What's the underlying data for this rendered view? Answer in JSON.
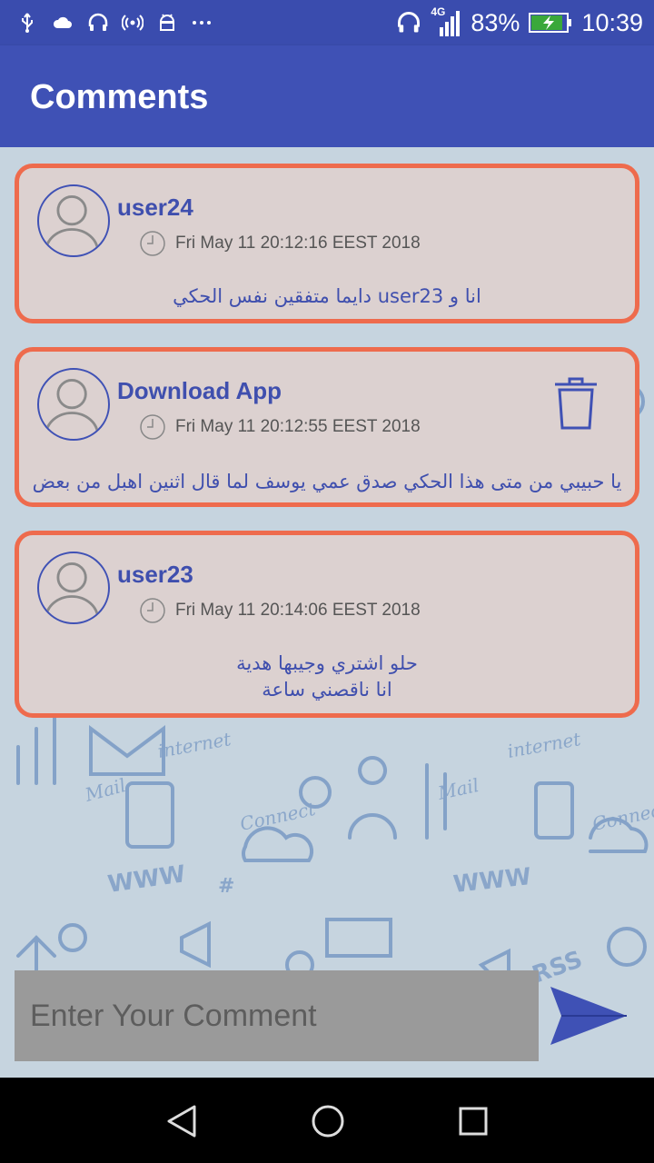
{
  "status_bar": {
    "network": "4G",
    "battery": "83%",
    "time": "10:39",
    "left_icons": [
      "usb-icon",
      "cloud-icon",
      "headset-icon",
      "hotspot-icon",
      "android-icon",
      "more-icon"
    ]
  },
  "app_bar": {
    "title": "Comments"
  },
  "comments": [
    {
      "username": "user24",
      "timestamp": "Fri May 11 20:12:16 EEST 2018",
      "text": "انا و user23 دايما متفقين نفس الحكي",
      "deletable": false
    },
    {
      "username": "Download App",
      "timestamp": "Fri May 11 20:12:55 EEST 2018",
      "text": "يا حبيبي من متى هذا الحكي صدق عمي يوسف لما قال اثنين اهبل من بعض",
      "deletable": true
    },
    {
      "username": "user23",
      "timestamp": "Fri May 11 20:14:06 EEST 2018",
      "text_line1": "حلو اشتري وجيبها هدية",
      "text_line2": "انا ناقصني ساعة",
      "deletable": false
    }
  ],
  "input": {
    "placeholder": "Enter Your Comment",
    "value": ""
  },
  "colors": {
    "primary": "#3f51b5",
    "status_bar": "#3a4cae",
    "card_border": "#ee6b4d",
    "card_bg": "#dcd1d0",
    "input_bg": "#9a9a9a"
  }
}
